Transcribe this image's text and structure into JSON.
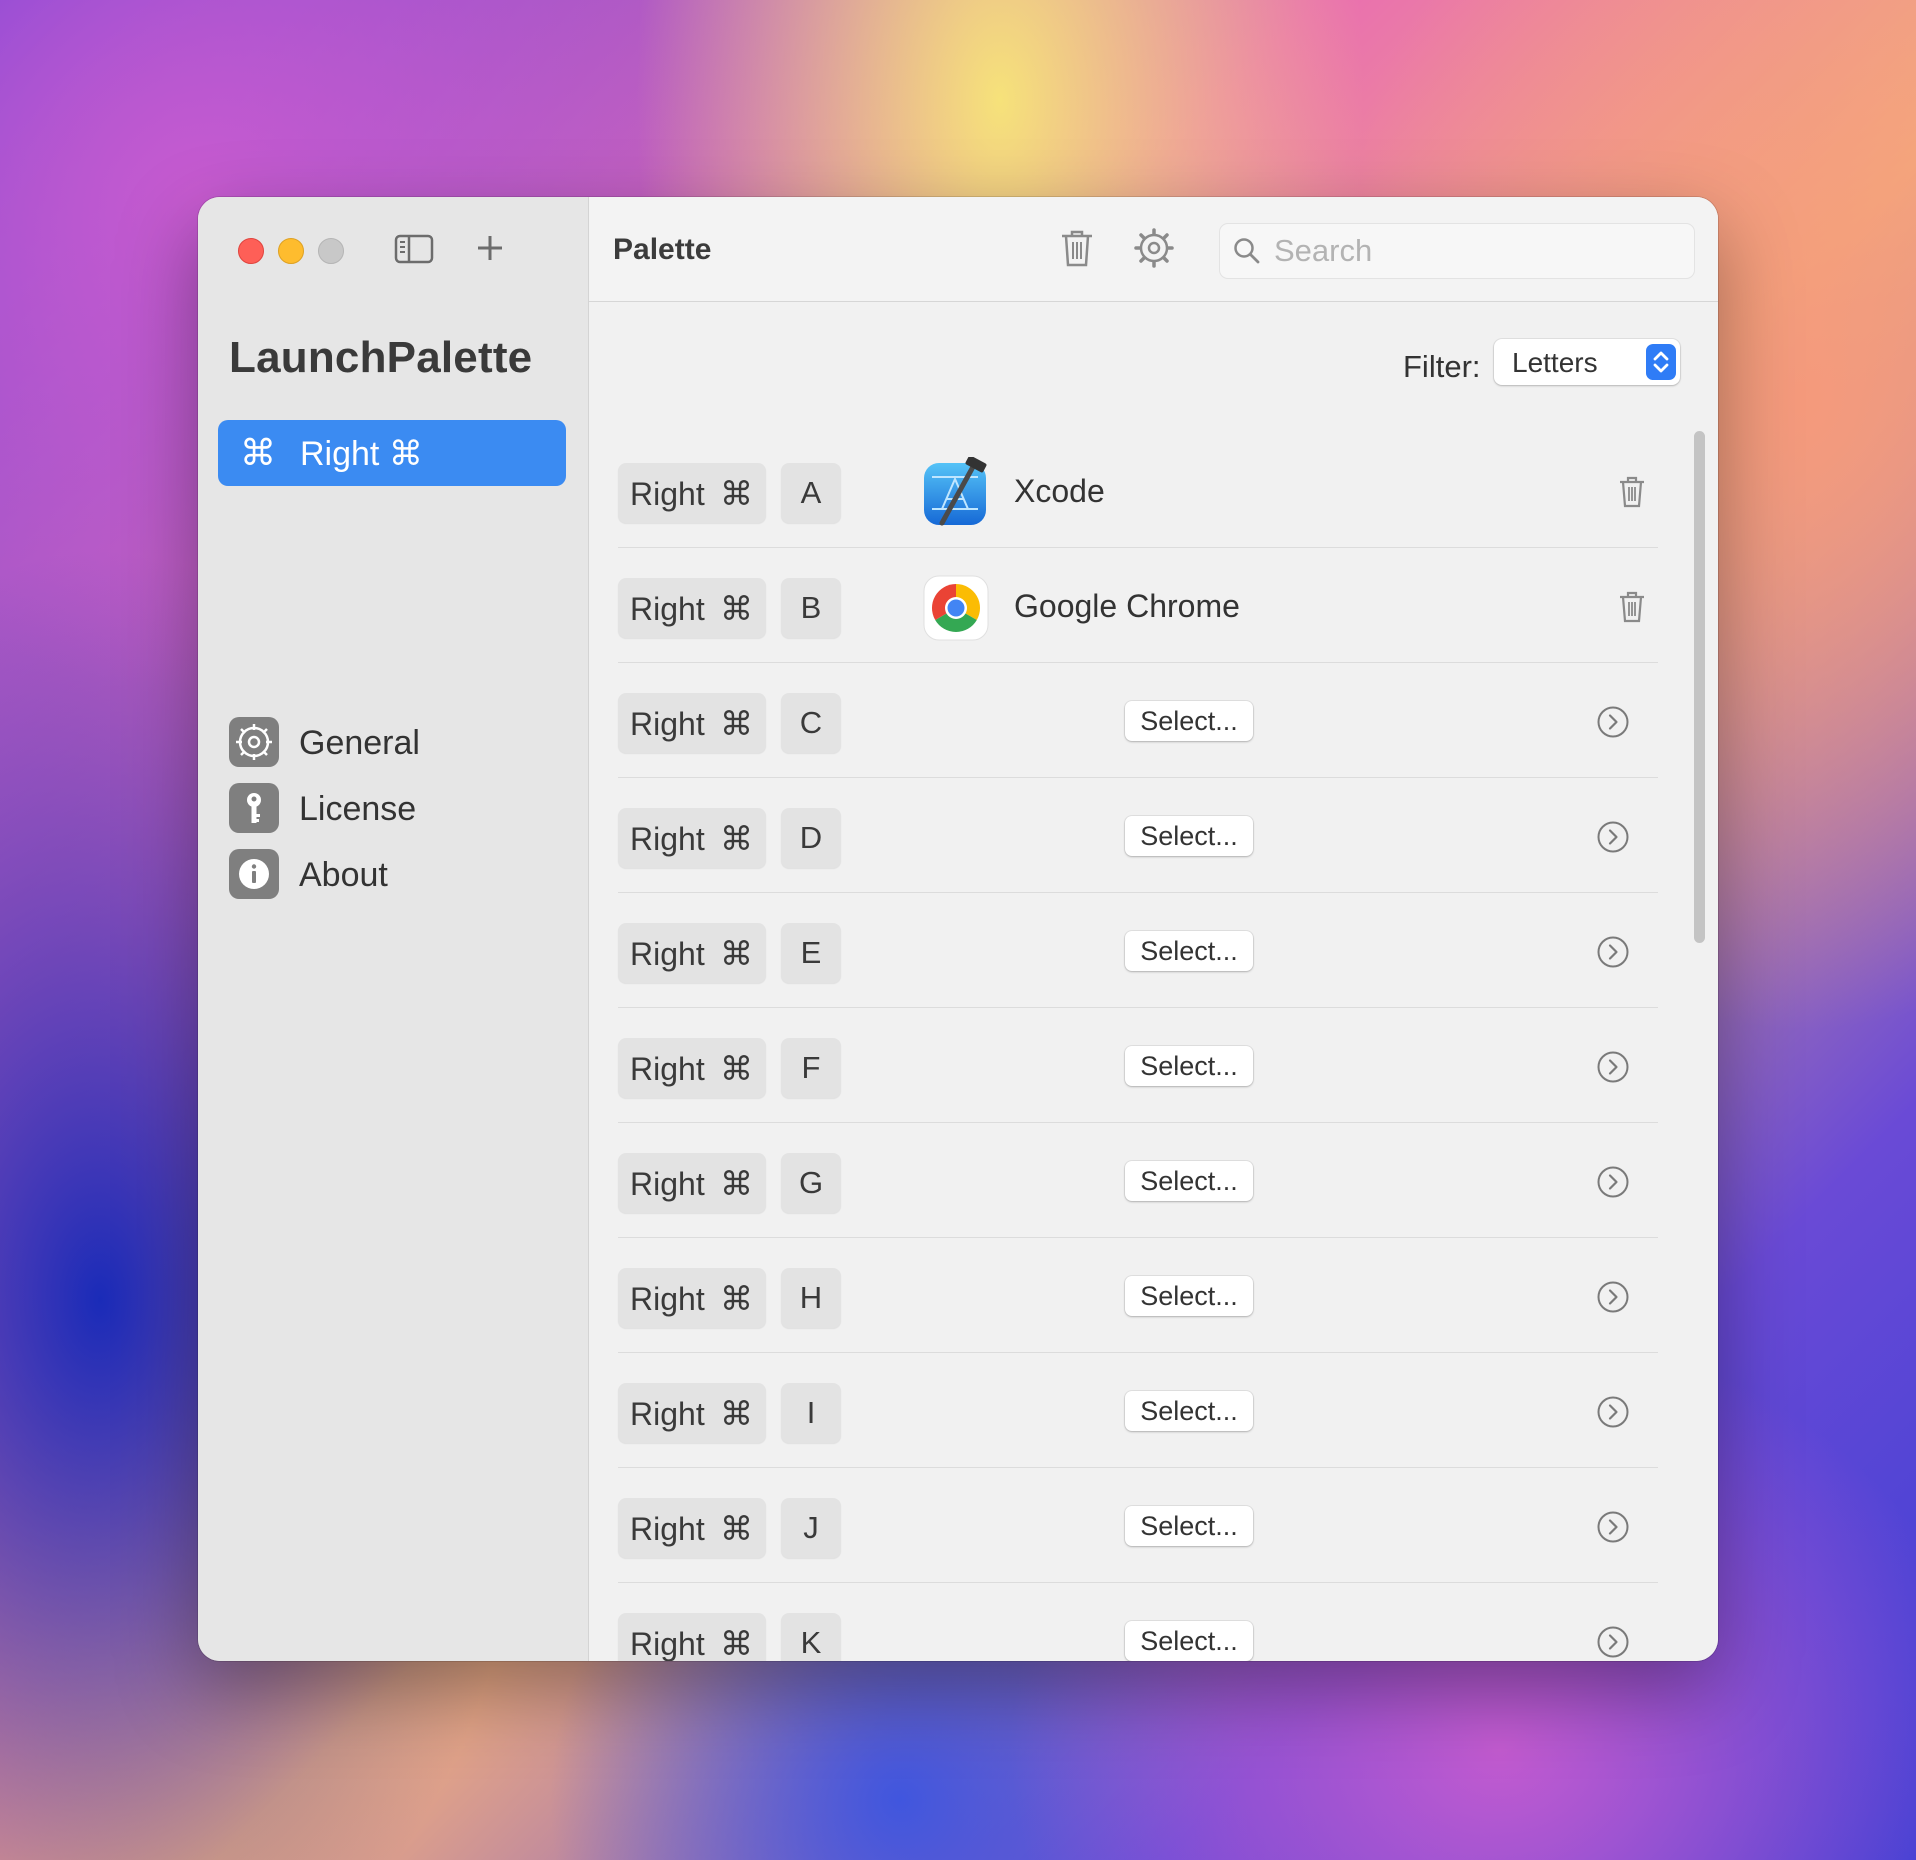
{
  "window": {
    "app_title": "LaunchPalette"
  },
  "sidebar": {
    "selected": {
      "glyph": "⌘",
      "label": "Right ⌘"
    },
    "items": [
      {
        "label": "General",
        "icon": "gear-icon"
      },
      {
        "label": "License",
        "icon": "key-icon"
      },
      {
        "label": "About",
        "icon": "info-icon"
      }
    ]
  },
  "toolbar": {
    "title": "Palette",
    "search_placeholder": "Search"
  },
  "filter": {
    "label": "Filter:",
    "value": "Letters"
  },
  "rows": [
    {
      "modifier": "Right",
      "modifier_glyph": "⌘",
      "key": "A",
      "app": "Xcode"
    },
    {
      "modifier": "Right",
      "modifier_glyph": "⌘",
      "key": "B",
      "app": "Google Chrome"
    },
    {
      "modifier": "Right",
      "modifier_glyph": "⌘",
      "key": "C",
      "select_label": "Select..."
    },
    {
      "modifier": "Right",
      "modifier_glyph": "⌘",
      "key": "D",
      "select_label": "Select..."
    },
    {
      "modifier": "Right",
      "modifier_glyph": "⌘",
      "key": "E",
      "select_label": "Select..."
    },
    {
      "modifier": "Right",
      "modifier_glyph": "⌘",
      "key": "F",
      "select_label": "Select..."
    },
    {
      "modifier": "Right",
      "modifier_glyph": "⌘",
      "key": "G",
      "select_label": "Select..."
    },
    {
      "modifier": "Right",
      "modifier_glyph": "⌘",
      "key": "H",
      "select_label": "Select..."
    },
    {
      "modifier": "Right",
      "modifier_glyph": "⌘",
      "key": "I",
      "select_label": "Select..."
    },
    {
      "modifier": "Right",
      "modifier_glyph": "⌘",
      "key": "J",
      "select_label": "Select..."
    },
    {
      "modifier": "Right",
      "modifier_glyph": "⌘",
      "key": "K",
      "select_label": "Select..."
    }
  ],
  "colors": {
    "accent": "#3b8bf2",
    "close": "#fe5f57",
    "minimize": "#febc2e"
  }
}
